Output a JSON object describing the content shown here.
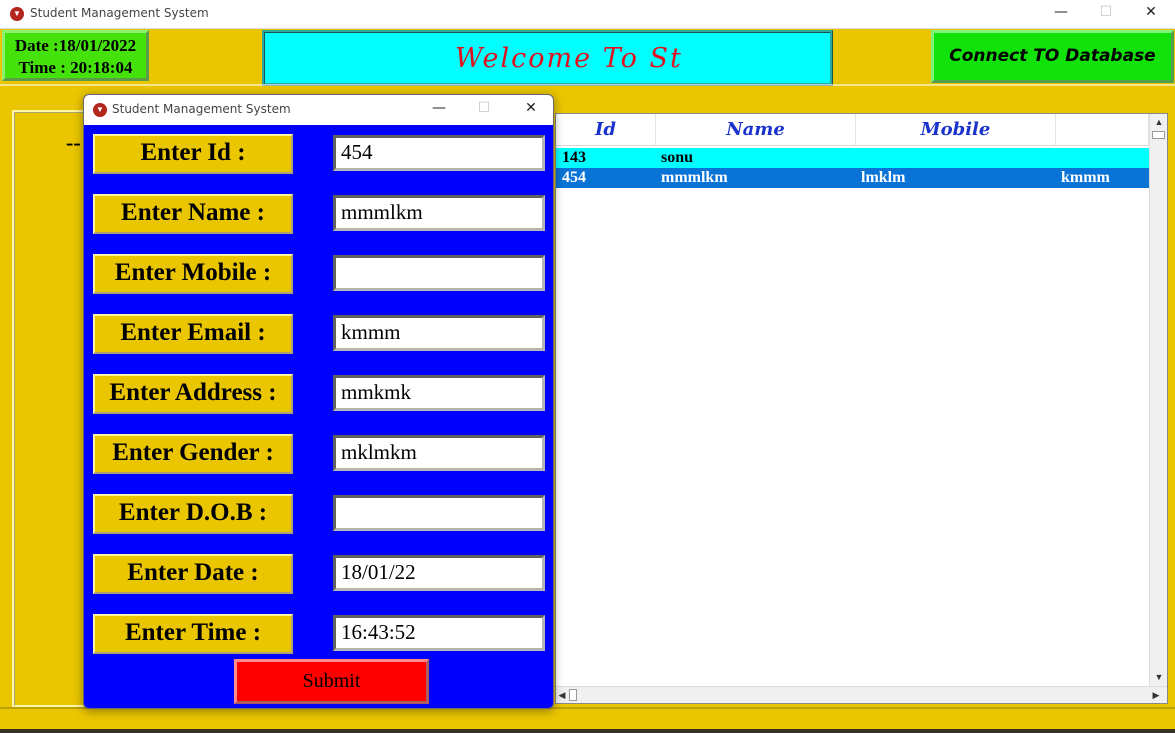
{
  "main_window": {
    "title": "Student Management System",
    "controls": {
      "minimize": "—",
      "maximize": "☐",
      "close": "✕"
    }
  },
  "header": {
    "date_line": "Date :18/01/2022",
    "time_line": "Time : 20:18:04",
    "welcome_text": "Welcome To St",
    "connect_button": "Connect TO Database"
  },
  "left_panel": {
    "partial_text": "--"
  },
  "table": {
    "columns": [
      "Id",
      "Name",
      "Mobile"
    ],
    "rows": [
      {
        "id": "143",
        "name": "sonu",
        "mobile": "",
        "extra": ""
      },
      {
        "id": "454",
        "name": "mmmlkm",
        "mobile": "lmklm",
        "extra": "kmmm"
      }
    ],
    "selected_row_index": 1,
    "row_colors": {
      "normal": "#00ffff",
      "selected": "#0a73d6"
    }
  },
  "dialog": {
    "title": "Student Management System",
    "fields": [
      {
        "label": "Enter Id :",
        "value": "454"
      },
      {
        "label": "Enter Name :",
        "value": "mmmlkm"
      },
      {
        "label": "Enter Mobile :",
        "value": ""
      },
      {
        "label": "Enter Email :",
        "value": "kmmm"
      },
      {
        "label": "Enter Address :",
        "value": "mmkmk"
      },
      {
        "label": "Enter Gender :",
        "value": "mklmkm"
      },
      {
        "label": "Enter D.O.B :",
        "value": ""
      },
      {
        "label": "Enter Date :",
        "value": "18/01/22"
      },
      {
        "label": "Enter Time :",
        "value": "16:43:52"
      }
    ],
    "submit_label": "Submit"
  },
  "colors": {
    "background": "#eac600",
    "dialog_bg": "#0000ff",
    "welcome_bg": "#00ffff",
    "welcome_text": "#e0101e",
    "connect_bg": "#11e20a",
    "submit_bg": "#ff0000"
  }
}
